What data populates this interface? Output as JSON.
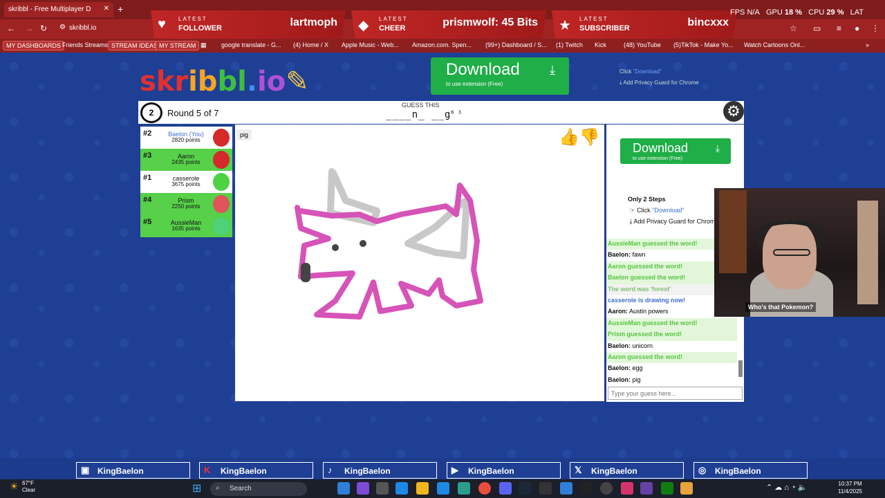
{
  "browser": {
    "tab_title": "skribbl - Free Multiplayer D",
    "url": "skribbl.io",
    "bookmarks": [
      "MY DASHBOARDS",
      "Friends Streams",
      "STREAM IDEAS",
      "MY STREAM",
      "google translate - G...",
      "(4) Home / X",
      "Apple Music - Web...",
      "Amazon.com. Spen...",
      "(99+) Dashboard / S...",
      "(1) Twitch",
      "Kick",
      "(48) YouTube",
      "(5)TikTok - Make Yo...",
      "Watch Cartoons Onl..."
    ]
  },
  "alerts": [
    {
      "kicker": "LATEST",
      "kind": "FOLLOWER",
      "value": "lartmoph"
    },
    {
      "kicker": "LATEST",
      "kind": "CHEER",
      "value": "prismwolf: 45 Bits"
    },
    {
      "kicker": "LATEST",
      "kind": "SUBSCRIBER",
      "value": "bincxxx"
    }
  ],
  "sys": {
    "fps": "FPS N/A",
    "gpu": "GPU",
    "gpu_val": "18 %",
    "cpu": "CPU",
    "cpu_val": "29 %",
    "lat": "LAT"
  },
  "logo": "skribbl.io",
  "download": {
    "label": "Download",
    "sub": "to use extension (Free)"
  },
  "topinfo": {
    "click": "Click",
    "link": "\"Download\"",
    "guard": "Add Privacy Guard for Chrome"
  },
  "game": {
    "timer": "2",
    "round": "Round 5 of 7",
    "guess_label": "GUESS THIS",
    "hint": "____n_ __g",
    "hint_counts": "6 3",
    "word_tag": "pig"
  },
  "players": [
    {
      "rank": "#2",
      "name": "Baelon (You)",
      "points": "2820 points",
      "color": "#ffffff",
      "name_color": "#3f6fd0",
      "avatar": "#d42a2a"
    },
    {
      "rank": "#3",
      "name": "Aaron",
      "points": "2435 points",
      "color": "#57d04a",
      "name_color": "#111",
      "avatar": "#d42a2a"
    },
    {
      "rank": "#1",
      "name": "casserole",
      "points": "3675 points",
      "color": "#ffffff",
      "name_color": "#111",
      "avatar": "#4ed244"
    },
    {
      "rank": "#4",
      "name": "Prism",
      "points": "2250 points",
      "color": "#57d04a",
      "name_color": "#111",
      "avatar": "#e0545b"
    },
    {
      "rank": "#5",
      "name": "AussieMan",
      "points": "1635 points",
      "color": "#57d04a",
      "name_color": "#111",
      "avatar": "#4ed27a"
    }
  ],
  "steps": {
    "title": "Only 2 Steps",
    "s1": "Click",
    "s1_link": "\"Download\"",
    "s2": "Add Privacy Guard for Chrome"
  },
  "chat": [
    {
      "type": "g",
      "name": "",
      "text": "AussieMan guessed the word!"
    },
    {
      "type": "m",
      "name": "Baelon:",
      "text": " fawn"
    },
    {
      "type": "g",
      "name": "",
      "text": "Aaron guessed the word!"
    },
    {
      "type": "g",
      "name": "",
      "text": "Baelon guessed the word!"
    },
    {
      "type": "w",
      "name": "",
      "text": "The word was 'forest'"
    },
    {
      "type": "b",
      "name": "",
      "text": "casserole is drawing now!"
    },
    {
      "type": "m",
      "name": "Aaron:",
      "text": " Austin powers"
    },
    {
      "type": "g",
      "name": "",
      "text": "AussieMan guessed the word!"
    },
    {
      "type": "g",
      "name": "",
      "text": "Prism guessed the word!"
    },
    {
      "type": "m",
      "name": "Baelon:",
      "text": " unicorn"
    },
    {
      "type": "g",
      "name": "",
      "text": "Aaron guessed the word!"
    },
    {
      "type": "m",
      "name": "Baelon:",
      "text": " egg"
    },
    {
      "type": "m",
      "name": "Baelon:",
      "text": " pig"
    }
  ],
  "chat_placeholder": "Type your guess here...",
  "webcam_caption": "Who's that Pokemon?",
  "socials": [
    "KingBaelon",
    "KingBaelon",
    "KingBaelon",
    "KingBaelon",
    "KingBaelon",
    "KingBaelon"
  ],
  "taskbar": {
    "temp": "67°F",
    "cond": "Clear",
    "search": "Search",
    "time": "10:37 PM",
    "date": "11/4/2025"
  }
}
